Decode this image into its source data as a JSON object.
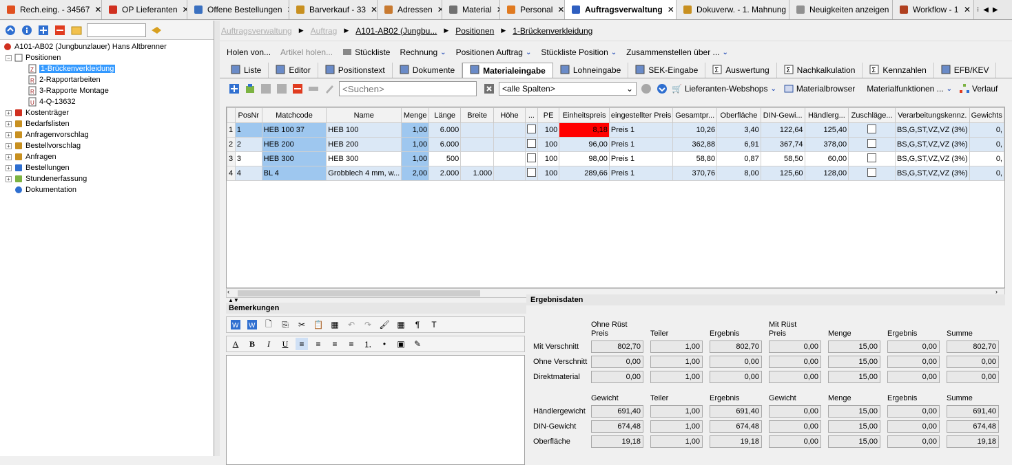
{
  "tabs": [
    {
      "label": "Rech.eing. - 34567",
      "icon": "invoice-icon"
    },
    {
      "label": "OP Lieferanten",
      "icon": "supplier-icon"
    },
    {
      "label": "Offene Bestellungen",
      "icon": "orders-icon"
    },
    {
      "label": "Barverkauf - 33",
      "icon": "cash-icon"
    },
    {
      "label": "Adressen",
      "icon": "address-book-icon"
    },
    {
      "label": "Material",
      "icon": "material-icon"
    },
    {
      "label": "Personal",
      "icon": "staff-icon"
    },
    {
      "label": "Auftragsverwaltung",
      "icon": "order-management-icon"
    },
    {
      "label": "Dokuverw. - 1. Mahnung",
      "icon": "document-icon"
    },
    {
      "label": "Neuigkeiten anzeigen",
      "icon": "news-icon"
    },
    {
      "label": "Workflow - 1",
      "icon": "workflow-icon"
    }
  ],
  "active_tab": 7,
  "tree": {
    "root": "A101-AB02 (Jungbunzlauer) Hans Altbrenner",
    "positionen_label": "Positionen",
    "positionen": [
      "1-Brückenverkleidung",
      "2-Rapportarbeiten",
      "3-Rapporte Montage",
      "4-Q-13632"
    ],
    "selected": 0,
    "sections": [
      "Kostenträger",
      "Bedarfslisten",
      "Anfragenvorschlag",
      "Bestellvorschlag",
      "Anfragen",
      "Bestellungen",
      "Stundenerfassung",
      "Dokumentation"
    ]
  },
  "breadcrumb": [
    "Auftragsverwaltung",
    "Auftrag",
    "A101-AB02 (Jungbu...",
    "Positionen",
    "1-Brückenverkleidung"
  ],
  "menubar": [
    {
      "label": "Holen von...",
      "disabled": false,
      "icon": "",
      "dropdown": false
    },
    {
      "label": "Artikel holen...",
      "disabled": true,
      "icon": "",
      "dropdown": false
    },
    {
      "label": "Stückliste",
      "disabled": false,
      "icon": "parts-list-icon",
      "dropdown": false
    },
    {
      "label": "Rechnung",
      "disabled": false,
      "icon": "",
      "dropdown": true
    },
    {
      "label": "Positionen Auftrag",
      "disabled": false,
      "icon": "",
      "dropdown": true
    },
    {
      "label": "Stückliste Position",
      "disabled": false,
      "icon": "",
      "dropdown": true
    },
    {
      "label": "Zusammenstellen über ...",
      "disabled": false,
      "icon": "",
      "dropdown": true
    }
  ],
  "subtabs": [
    {
      "label": "Liste",
      "icon": "list-icon"
    },
    {
      "label": "Editor",
      "icon": "edit-icon"
    },
    {
      "label": "Positionstext",
      "icon": "text-icon"
    },
    {
      "label": "Dokumente",
      "icon": "documents-icon"
    },
    {
      "label": "Materialeingabe",
      "icon": "material-input-icon"
    },
    {
      "label": "Lohneingabe",
      "icon": "wage-icon"
    },
    {
      "label": "SEK-Eingabe",
      "icon": "sek-icon"
    },
    {
      "label": "Auswertung",
      "icon": "sum-icon"
    },
    {
      "label": "Nachkalkulation",
      "icon": "sum-icon"
    },
    {
      "label": "Kennzahlen",
      "icon": "sum-icon"
    },
    {
      "label": "EFB/KEV",
      "icon": "efb-icon"
    }
  ],
  "active_subtab": 4,
  "gridtoolbar": {
    "search_placeholder": "<Suchen>",
    "column_select": "<alle Spalten>",
    "webshops": "Lieferanten-Webshops",
    "materialbrowser": "Materialbrowser",
    "materialfunktionen": "Materialfunktionen ...",
    "verlauf": "Verlauf"
  },
  "grid": {
    "columns": [
      "PosNr",
      "Matchcode",
      "Name",
      "Menge",
      "Länge",
      "Breite",
      "Höhe",
      "...",
      "PE",
      "Einheitspreis",
      "eingestellter Preis",
      "Gesamtpr...",
      "Oberfläche",
      "DIN-Gewi...",
      "Händlerg...",
      "Zuschläge...",
      "Verarbeitungskennz.",
      "Gewichts"
    ],
    "rows": [
      {
        "n": "1",
        "posnr": "1",
        "matchcode": "HEB 100 37",
        "name": "HEB 100",
        "menge": "1,00",
        "laenge": "6.000",
        "breite": "",
        "hoehe": "",
        "pe": "100",
        "einheitspreis": "8,18",
        "preis": "Preis 1",
        "gesamt": "10,26",
        "oberflaeche": "3,40",
        "din": "122,64",
        "haendler": "125,40",
        "verarb": "BS,G,ST,VZ,VZ (3%)",
        "gewichts": "0,"
      },
      {
        "n": "2",
        "posnr": "2",
        "matchcode": "HEB 200",
        "name": "HEB 200",
        "menge": "1,00",
        "laenge": "6.000",
        "breite": "",
        "hoehe": "",
        "pe": "100",
        "einheitspreis": "96,00",
        "preis": "Preis 1",
        "gesamt": "362,88",
        "oberflaeche": "6,91",
        "din": "367,74",
        "haendler": "378,00",
        "verarb": "BS,G,ST,VZ,VZ (3%)",
        "gewichts": "0,"
      },
      {
        "n": "3",
        "posnr": "3",
        "matchcode": "HEB 300",
        "name": "HEB 300",
        "menge": "1,00",
        "laenge": "500",
        "breite": "",
        "hoehe": "",
        "pe": "100",
        "einheitspreis": "98,00",
        "preis": "Preis 1",
        "gesamt": "58,80",
        "oberflaeche": "0,87",
        "din": "58,50",
        "haendler": "60,00",
        "verarb": "BS,G,ST,VZ,VZ (3%)",
        "gewichts": "0,"
      },
      {
        "n": "4",
        "posnr": "4",
        "matchcode": "BL 4",
        "name": "Grobblech 4 mm, w...",
        "menge": "2,00",
        "laenge": "2.000",
        "breite": "1.000",
        "hoehe": "",
        "pe": "100",
        "einheitspreis": "289,66",
        "preis": "Preis 1",
        "gesamt": "370,76",
        "oberflaeche": "8,00",
        "din": "125,60",
        "haendler": "128,00",
        "verarb": "BS,G,ST,VZ,VZ (3%)",
        "gewichts": "0,"
      }
    ],
    "highlight_color": "#ff0000"
  },
  "bemerkungen": {
    "title": "Bemerkungen"
  },
  "ergebnis": {
    "title": "Ergebnisdaten",
    "head1": [
      "Ohne Rüst\nPreis",
      "Teiler",
      "Ergebnis",
      "Mit Rüst\nPreis",
      "Menge",
      "Ergebnis",
      "Summe"
    ],
    "rows1": [
      {
        "label": "Mit Verschnitt",
        "v": [
          "802,70",
          "1,00",
          "802,70",
          "0,00",
          "15,00",
          "0,00",
          "802,70"
        ]
      },
      {
        "label": "Ohne Verschnitt",
        "v": [
          "0,00",
          "1,00",
          "0,00",
          "0,00",
          "15,00",
          "0,00",
          "0,00"
        ]
      },
      {
        "label": "Direktmaterial",
        "v": [
          "0,00",
          "1,00",
          "0,00",
          "0,00",
          "15,00",
          "0,00",
          "0,00"
        ]
      }
    ],
    "head2": [
      "Gewicht",
      "Teiler",
      "Ergebnis",
      "Gewicht",
      "Menge",
      "Ergebnis",
      "Summe"
    ],
    "rows2": [
      {
        "label": "Händlergewicht",
        "v": [
          "691,40",
          "1,00",
          "691,40",
          "0,00",
          "15,00",
          "0,00",
          "691,40"
        ]
      },
      {
        "label": "DIN-Gewicht",
        "v": [
          "674,48",
          "1,00",
          "674,48",
          "0,00",
          "15,00",
          "0,00",
          "674,48"
        ]
      },
      {
        "label": "Oberfläche",
        "v": [
          "19,18",
          "1,00",
          "19,18",
          "0,00",
          "15,00",
          "0,00",
          "19,18"
        ]
      }
    ]
  }
}
